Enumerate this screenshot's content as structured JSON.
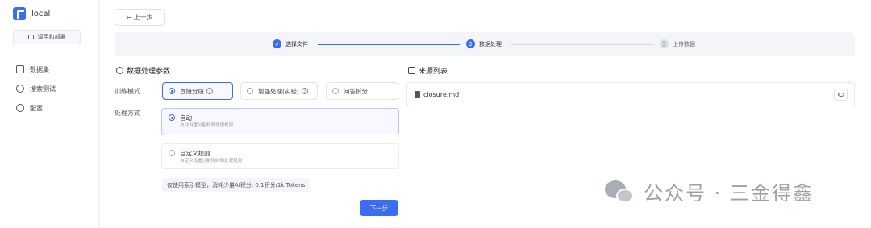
{
  "sidebar": {
    "brand": "local",
    "app_button": "调用和部署",
    "nav": [
      {
        "label": "数据集",
        "icon": "dataset-icon"
      },
      {
        "label": "搜索测试",
        "icon": "search-test-icon"
      },
      {
        "label": "配置",
        "icon": "gear-icon"
      }
    ]
  },
  "toolbar": {
    "back_label": "← 上一步"
  },
  "steps": [
    {
      "label": "选择文件",
      "state": "done",
      "marker": "✓"
    },
    {
      "label": "数据处理",
      "state": "current",
      "marker": "2"
    },
    {
      "label": "上传数据",
      "state": "pending",
      "marker": "3"
    }
  ],
  "left": {
    "title": "数据处理参数",
    "mode_label": "训练模式",
    "mode_options": [
      {
        "label": "直接分段",
        "selected": true
      },
      {
        "label": "增强处理(实验)",
        "selected": false
      },
      {
        "label": "问答拆分",
        "selected": false
      }
    ],
    "method_label": "处理方式",
    "methods": [
      {
        "title": "自动",
        "desc": "自动设置分割和预处理规则",
        "selected": true
      },
      {
        "title": "自定义规则",
        "desc": "自定义设置分割规则和处理规则",
        "selected": false
      }
    ],
    "hint": "仅使用索引模型，消耗少量AI积分: 0.1积分/1k Tokens",
    "next_label": "下一步"
  },
  "right": {
    "title": "来源列表",
    "files": [
      {
        "name": "closure.md"
      }
    ]
  },
  "watermark": {
    "text": "公众号 · 三金得鑫"
  },
  "colors": {
    "accent": "#3c6cf0"
  }
}
